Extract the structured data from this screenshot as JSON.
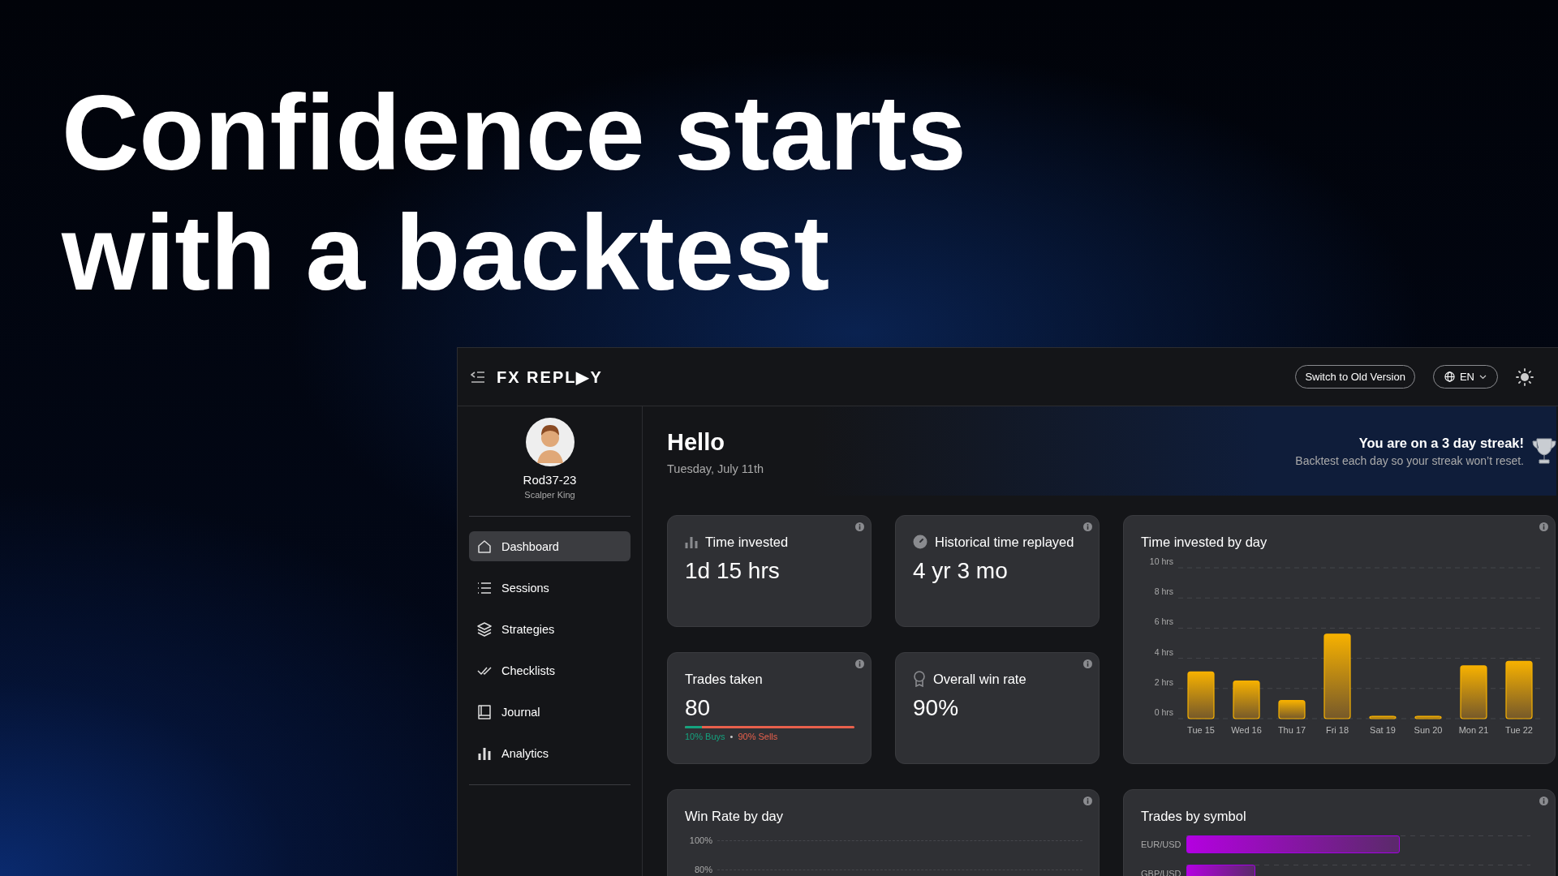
{
  "headline": [
    "Confidence starts",
    "with a backtest"
  ],
  "topbar": {
    "logo": "FX REPL▶Y",
    "buttons": [
      "Switch to Old Version"
    ],
    "language": "EN"
  },
  "profile": {
    "name": "Rod37-23",
    "rank": "Scalper King"
  },
  "nav": [
    {
      "label": "Dashboard",
      "selected": true
    },
    {
      "label": "Sessions",
      "selected": false
    },
    {
      "label": "Strategies",
      "selected": false
    },
    {
      "label": "Checklists",
      "selected": false
    },
    {
      "label": "Journal",
      "selected": false
    },
    {
      "label": "Analytics",
      "selected": false
    }
  ],
  "greeting": {
    "title": "Hello",
    "date": "Tuesday, July 11th"
  },
  "streak": {
    "title": "You are on a 3 day streak!",
    "text": "Backtest each day so your streak won’t reset."
  },
  "stats": [
    {
      "kind": "time",
      "title": "Time invested",
      "value": "1d 15 hrs"
    },
    {
      "kind": "history",
      "title": "Historical time replayed",
      "value": "4 yr 3 mo"
    },
    {
      "kind": "trades",
      "title": "Trades taken",
      "value": "80",
      "level": 0.1,
      "buys": "10% Buys",
      "separator": "•",
      "sells": "90% Sells"
    },
    {
      "kind": "winrate",
      "title": "Overall win rate",
      "value": "90%"
    }
  ],
  "time_by_day": {
    "chart_data": {
      "type": "bar",
      "title": "Time invested by day",
      "categories": [
        "Tue 15",
        "Wed 16",
        "Thu 17",
        "Fri 18",
        "Sat 19",
        "Sun 20",
        "Mon 21",
        "Tue 22"
      ],
      "values": [
        3.1,
        2.5,
        1.2,
        5.6,
        0,
        0,
        3.5,
        3.8
      ],
      "grid": true,
      "ylim": [
        0,
        10
      ],
      "yticks": [
        {
          "value": 0,
          "label": "0 hrs"
        },
        {
          "value": 2,
          "label": "2 hrs"
        },
        {
          "value": 4,
          "label": "4 hrs"
        },
        {
          "value": 6,
          "label": "6 hrs"
        },
        {
          "value": 8,
          "label": "8 hrs"
        },
        {
          "value": 10,
          "label": "10 hrs"
        }
      ]
    }
  },
  "win_rate": {
    "title": "Win Rate by day",
    "y_labels": [
      "100%",
      "80%"
    ]
  },
  "symbols": {
    "title": "Trades by symbol",
    "items": [
      {
        "name": "EUR/USD",
        "level": 0.62
      },
      {
        "name": "GBP/USD",
        "level": 0.2
      }
    ]
  }
}
